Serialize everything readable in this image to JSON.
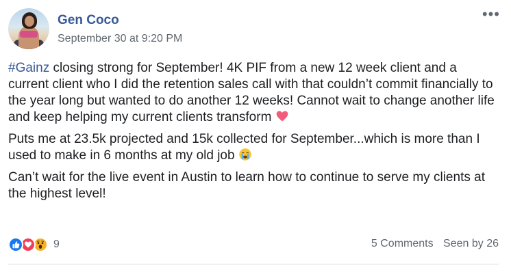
{
  "post": {
    "author": "Gen Coco",
    "timestamp": "September 30 at 9:20 PM",
    "more_label": "•••",
    "paragraphs": {
      "p1_hashtag": "#Gainz",
      "p1_text": " closing strong for September! 4K PIF from a new 12 week client and a current client who I did the retention sales call with that couldn’t commit financially to the year long but wanted to do another 12 weeks! Cannot wait to change another life and keep helping my current clients transform ",
      "p2_text": "Puts me at 23.5k projected and 15k collected for September...which is more than I used to make in 6 months at my old job ",
      "p3_text": "Can’t wait for the live event in Austin to learn how to continue to serve my clients at the highest level!"
    },
    "reactions": {
      "types": [
        "like-icon",
        "love-icon",
        "wow-icon"
      ],
      "count": "9"
    },
    "stats": {
      "comments": "5 Comments",
      "seen_by": "Seen by 26"
    }
  },
  "colors": {
    "author_link": "#385898",
    "text": "#1c1e21",
    "muted": "#606770",
    "like": "#1877f2",
    "love": "#f33e58",
    "wow": "#f7b125",
    "heart_emoji": "#f25c7a"
  }
}
